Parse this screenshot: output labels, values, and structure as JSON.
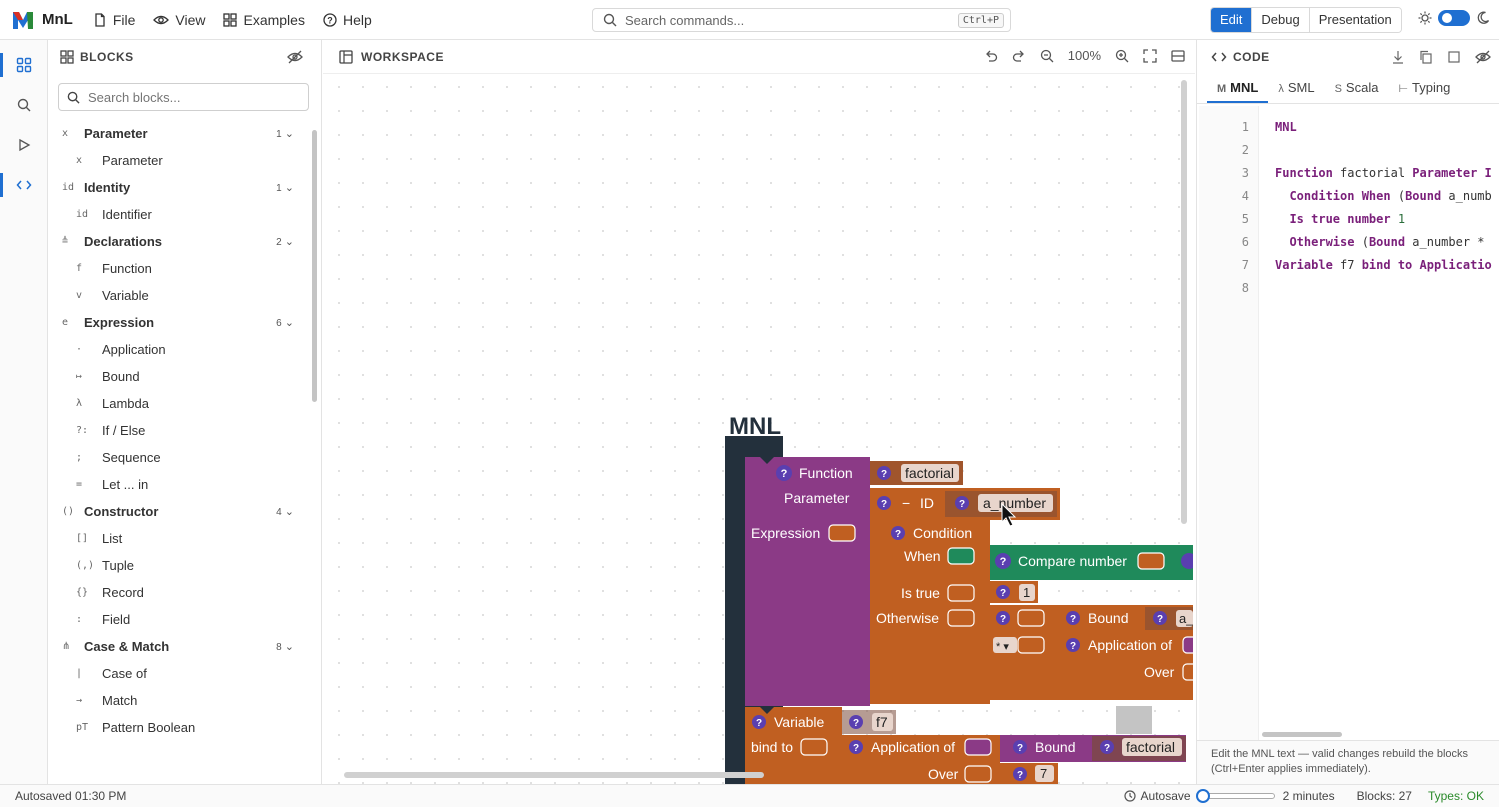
{
  "app": {
    "name": "MnL"
  },
  "menu": [
    {
      "label": "File",
      "icon": "file-icon"
    },
    {
      "label": "View",
      "icon": "eye-icon"
    },
    {
      "label": "Examples",
      "icon": "grid-icon"
    },
    {
      "label": "Help",
      "icon": "help-icon"
    }
  ],
  "search": {
    "placeholder": "Search commands...",
    "shortcut": "Ctrl+P"
  },
  "modes": {
    "edit": "Edit",
    "debug": "Debug",
    "presentation": "Presentation",
    "active": "Edit"
  },
  "blocks_panel": {
    "title": "BLOCKS",
    "search_placeholder": "Search blocks...",
    "categories": [
      {
        "sym": "x",
        "name": "Parameter",
        "count": "1",
        "items": [
          {
            "sym": "x",
            "name": "Parameter"
          }
        ]
      },
      {
        "sym": "id",
        "name": "Identity",
        "count": "1",
        "items": [
          {
            "sym": "id",
            "name": "Identifier"
          }
        ]
      },
      {
        "sym": "≜",
        "name": "Declarations",
        "count": "2",
        "items": [
          {
            "sym": "f",
            "name": "Function"
          },
          {
            "sym": "v",
            "name": "Variable"
          }
        ]
      },
      {
        "sym": "e",
        "name": "Expression",
        "count": "6",
        "items": [
          {
            "sym": "·",
            "name": "Application"
          },
          {
            "sym": "↦",
            "name": "Bound"
          },
          {
            "sym": "λ",
            "name": "Lambda"
          },
          {
            "sym": "?:",
            "name": "If / Else"
          },
          {
            "sym": ";",
            "name": "Sequence"
          },
          {
            "sym": "=",
            "name": "Let ... in"
          }
        ]
      },
      {
        "sym": "()",
        "name": "Constructor",
        "count": "4",
        "items": [
          {
            "sym": "[]",
            "name": "List"
          },
          {
            "sym": "(,)",
            "name": "Tuple"
          },
          {
            "sym": "{}",
            "name": "Record"
          },
          {
            "sym": ":",
            "name": "Field"
          }
        ]
      },
      {
        "sym": "⋔",
        "name": "Case & Match",
        "count": "8",
        "items": [
          {
            "sym": "|",
            "name": "Case of"
          },
          {
            "sym": "→",
            "name": "Match"
          },
          {
            "sym": "pT",
            "name": "Pattern Boolean"
          }
        ]
      }
    ]
  },
  "workspace": {
    "title": "WORKSPACE",
    "zoom": "100%",
    "blocks": {
      "hat": "MNL",
      "function_label": "Function",
      "function_name": "factorial",
      "parameter_label": "Parameter",
      "id_label": "ID",
      "param_name": "a_number",
      "expression_label": "Expression",
      "condition_label": "Condition",
      "when_label": "When",
      "compare_label": "Compare number",
      "is_true_label": "Is true",
      "is_true_value": "1",
      "otherwise_label": "Otherwise",
      "bound_label": "Bound",
      "bound_value": "a_",
      "operator": "* ▾",
      "application_label": "Application of",
      "over_label": "Over",
      "variable_label": "Variable",
      "variable_name": "f7",
      "bind_to_label": "bind to",
      "application_label2": "Application of",
      "bound_label2": "Bound",
      "bound_value2": "factorial",
      "over_label2": "Over",
      "over_value2": "7",
      "help_mark": "?",
      "dash": "−"
    }
  },
  "code_panel": {
    "title": "CODE",
    "tabs": [
      {
        "prefix": "M",
        "label": "MNL"
      },
      {
        "prefix": "λ",
        "label": "SML"
      },
      {
        "prefix": "S",
        "label": "Scala"
      },
      {
        "prefix": "⊢",
        "label": "Typing"
      }
    ],
    "lines": [
      {
        "n": "1",
        "parts": [
          {
            "t": "MNL",
            "k": "kw"
          }
        ]
      },
      {
        "n": "2",
        "parts": []
      },
      {
        "n": "3",
        "parts": [
          {
            "t": "Function",
            "k": "kw"
          },
          {
            "t": " factorial ",
            "k": ""
          },
          {
            "t": "Parameter I",
            "k": "kw"
          }
        ]
      },
      {
        "n": "4",
        "parts": [
          {
            "t": "  Condition When ",
            "k": "kw"
          },
          {
            "t": "(",
            "k": ""
          },
          {
            "t": "Bound",
            "k": "kw"
          },
          {
            "t": " a_numb",
            "k": ""
          }
        ]
      },
      {
        "n": "5",
        "parts": [
          {
            "t": "  Is true number ",
            "k": "kw"
          },
          {
            "t": "1",
            "k": "nm"
          }
        ]
      },
      {
        "n": "6",
        "parts": [
          {
            "t": "  Otherwise ",
            "k": "kw"
          },
          {
            "t": "(",
            "k": ""
          },
          {
            "t": "Bound",
            "k": "kw"
          },
          {
            "t": " a_number *",
            "k": ""
          }
        ]
      },
      {
        "n": "7",
        "parts": [
          {
            "t": "Variable",
            "k": "kw"
          },
          {
            "t": " f7 ",
            "k": ""
          },
          {
            "t": "bind to Applicatio",
            "k": "kw"
          }
        ]
      },
      {
        "n": "8",
        "parts": []
      }
    ],
    "hint": "Edit the MNL text — valid changes rebuild the blocks (Ctrl+Enter applies immediately)."
  },
  "status": {
    "autosaved": "Autosaved 01:30 PM",
    "autosave_label": "Autosave",
    "autosave_interval_fraction": 0,
    "interval": "2 minutes",
    "blocks_count": "Blocks: 27",
    "typing": "Types: OK"
  },
  "colors": {
    "accent": "#1f6fd1",
    "function_purple": "#8b3a86",
    "block_orange": "#c05f21",
    "compare_green": "#1f8a5b",
    "hat_dark": "#23303c"
  }
}
